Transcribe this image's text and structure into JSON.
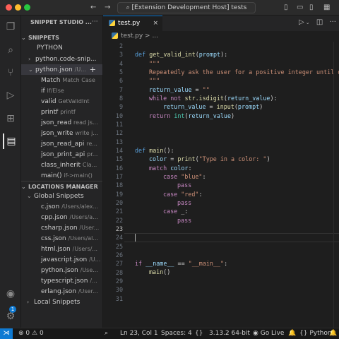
{
  "titlebar": {
    "search_text": "[Extension Development Host] tests",
    "traffic_colors": [
      "#ff5f57",
      "#febc2e",
      "#28c840"
    ]
  },
  "activity_bar": {
    "icons": [
      "explorer-icon",
      "search-icon",
      "source-control-icon",
      "run-debug-icon",
      "extensions-icon",
      "snippet-studio-icon",
      "account-icon",
      "settings-gear-icon"
    ],
    "badge": "1"
  },
  "sidebar": {
    "title": "SNIPPET STUDIO ...",
    "snippets_header": "SNIPPETS",
    "language": "PYTHON",
    "groups": [
      {
        "label": "python.code-snip..."
      },
      {
        "label": "python.json",
        "muted": "/U..."
      }
    ],
    "snippet_items": [
      {
        "name": "Match",
        "desc": "Match Case"
      },
      {
        "name": "if",
        "desc": "If/Else"
      },
      {
        "name": "valid",
        "desc": "GetValidInt"
      },
      {
        "name": "printf",
        "desc": "printf"
      },
      {
        "name": "json_read",
        "desc": "read js..."
      },
      {
        "name": "json_write",
        "desc": "write j..."
      },
      {
        "name": "json_read_api",
        "desc": "re..."
      },
      {
        "name": "json_print_api",
        "desc": "pr..."
      },
      {
        "name": "class_inherit",
        "desc": "Cla..."
      },
      {
        "name": "main()",
        "desc": "if->main()"
      }
    ],
    "locations_header": "LOCATIONS MANAGER",
    "global_snippets": "Global Snippets",
    "locations": [
      {
        "name": "c.json",
        "path": "/Users/alex..."
      },
      {
        "name": "cpp.json",
        "path": "/Users/a..."
      },
      {
        "name": "csharp.json",
        "path": "/User..."
      },
      {
        "name": "css.json",
        "path": "/Users/al..."
      },
      {
        "name": "html.json",
        "path": "/Users/..."
      },
      {
        "name": "javascript.json",
        "path": "/U..."
      },
      {
        "name": "python.json",
        "path": "/Use..."
      },
      {
        "name": "typescript.json",
        "path": "/..."
      },
      {
        "name": "erlang.json",
        "path": "/User..."
      }
    ],
    "local_snippets": "Local Snippets"
  },
  "editor": {
    "tab_label": "test.py",
    "breadcrumb": "test.py > ...",
    "line_numbers": [
      "2",
      "3",
      "4",
      "5",
      "6",
      "7",
      "8",
      "9",
      "10",
      "11",
      "12",
      "13",
      "14",
      "15",
      "16",
      "17",
      "18",
      "19",
      "20",
      "21",
      "22",
      "23",
      "24",
      "25",
      "26",
      "27",
      "28",
      "29",
      "30",
      "31"
    ],
    "current_line": "23",
    "code": {
      "l3_def": "def",
      "l3_name": "get_valid_int",
      "l3_param": "prompt",
      "l4": "\"\"\"",
      "l5": "Repeatedly ask the user for a positive integer until one",
      "l6": "\"\"\"",
      "l7_var": "return_value",
      "l7_str": "\"\"",
      "l8_kw": "while not",
      "l8_fn": "str.isdigit",
      "l8_arg": "return_value",
      "l9_var": "return_value",
      "l9_fn": "input",
      "l9_arg": "prompt",
      "l10_kw": "return",
      "l10_fn": "int",
      "l10_arg": "return_value",
      "l14_def": "def",
      "l14_name": "main",
      "l15_var": "color",
      "l15_fn": "print",
      "l15_str": "\"Type in a color: \"",
      "l16_kw": "match",
      "l16_var": "color",
      "l17_kw": "case",
      "l17_str": "\"blue\"",
      "l18": "pass",
      "l19_kw": "case",
      "l19_str": "\"red\"",
      "l20": "pass",
      "l21_kw": "case",
      "l21_rest": "_:",
      "l22": "pass",
      "l27_kw": "if",
      "l27_var": "__name__",
      "l27_str": "\"__main__\"",
      "l28_fn": "main"
    }
  },
  "statusbar": {
    "errors": "0",
    "warnings": "0",
    "position": "Ln 23, Col 1",
    "spaces": "Spaces: 4",
    "braces": "{}",
    "python_version": "3.13.2 64-bit",
    "go_live": "Go Live",
    "language": "Python"
  }
}
